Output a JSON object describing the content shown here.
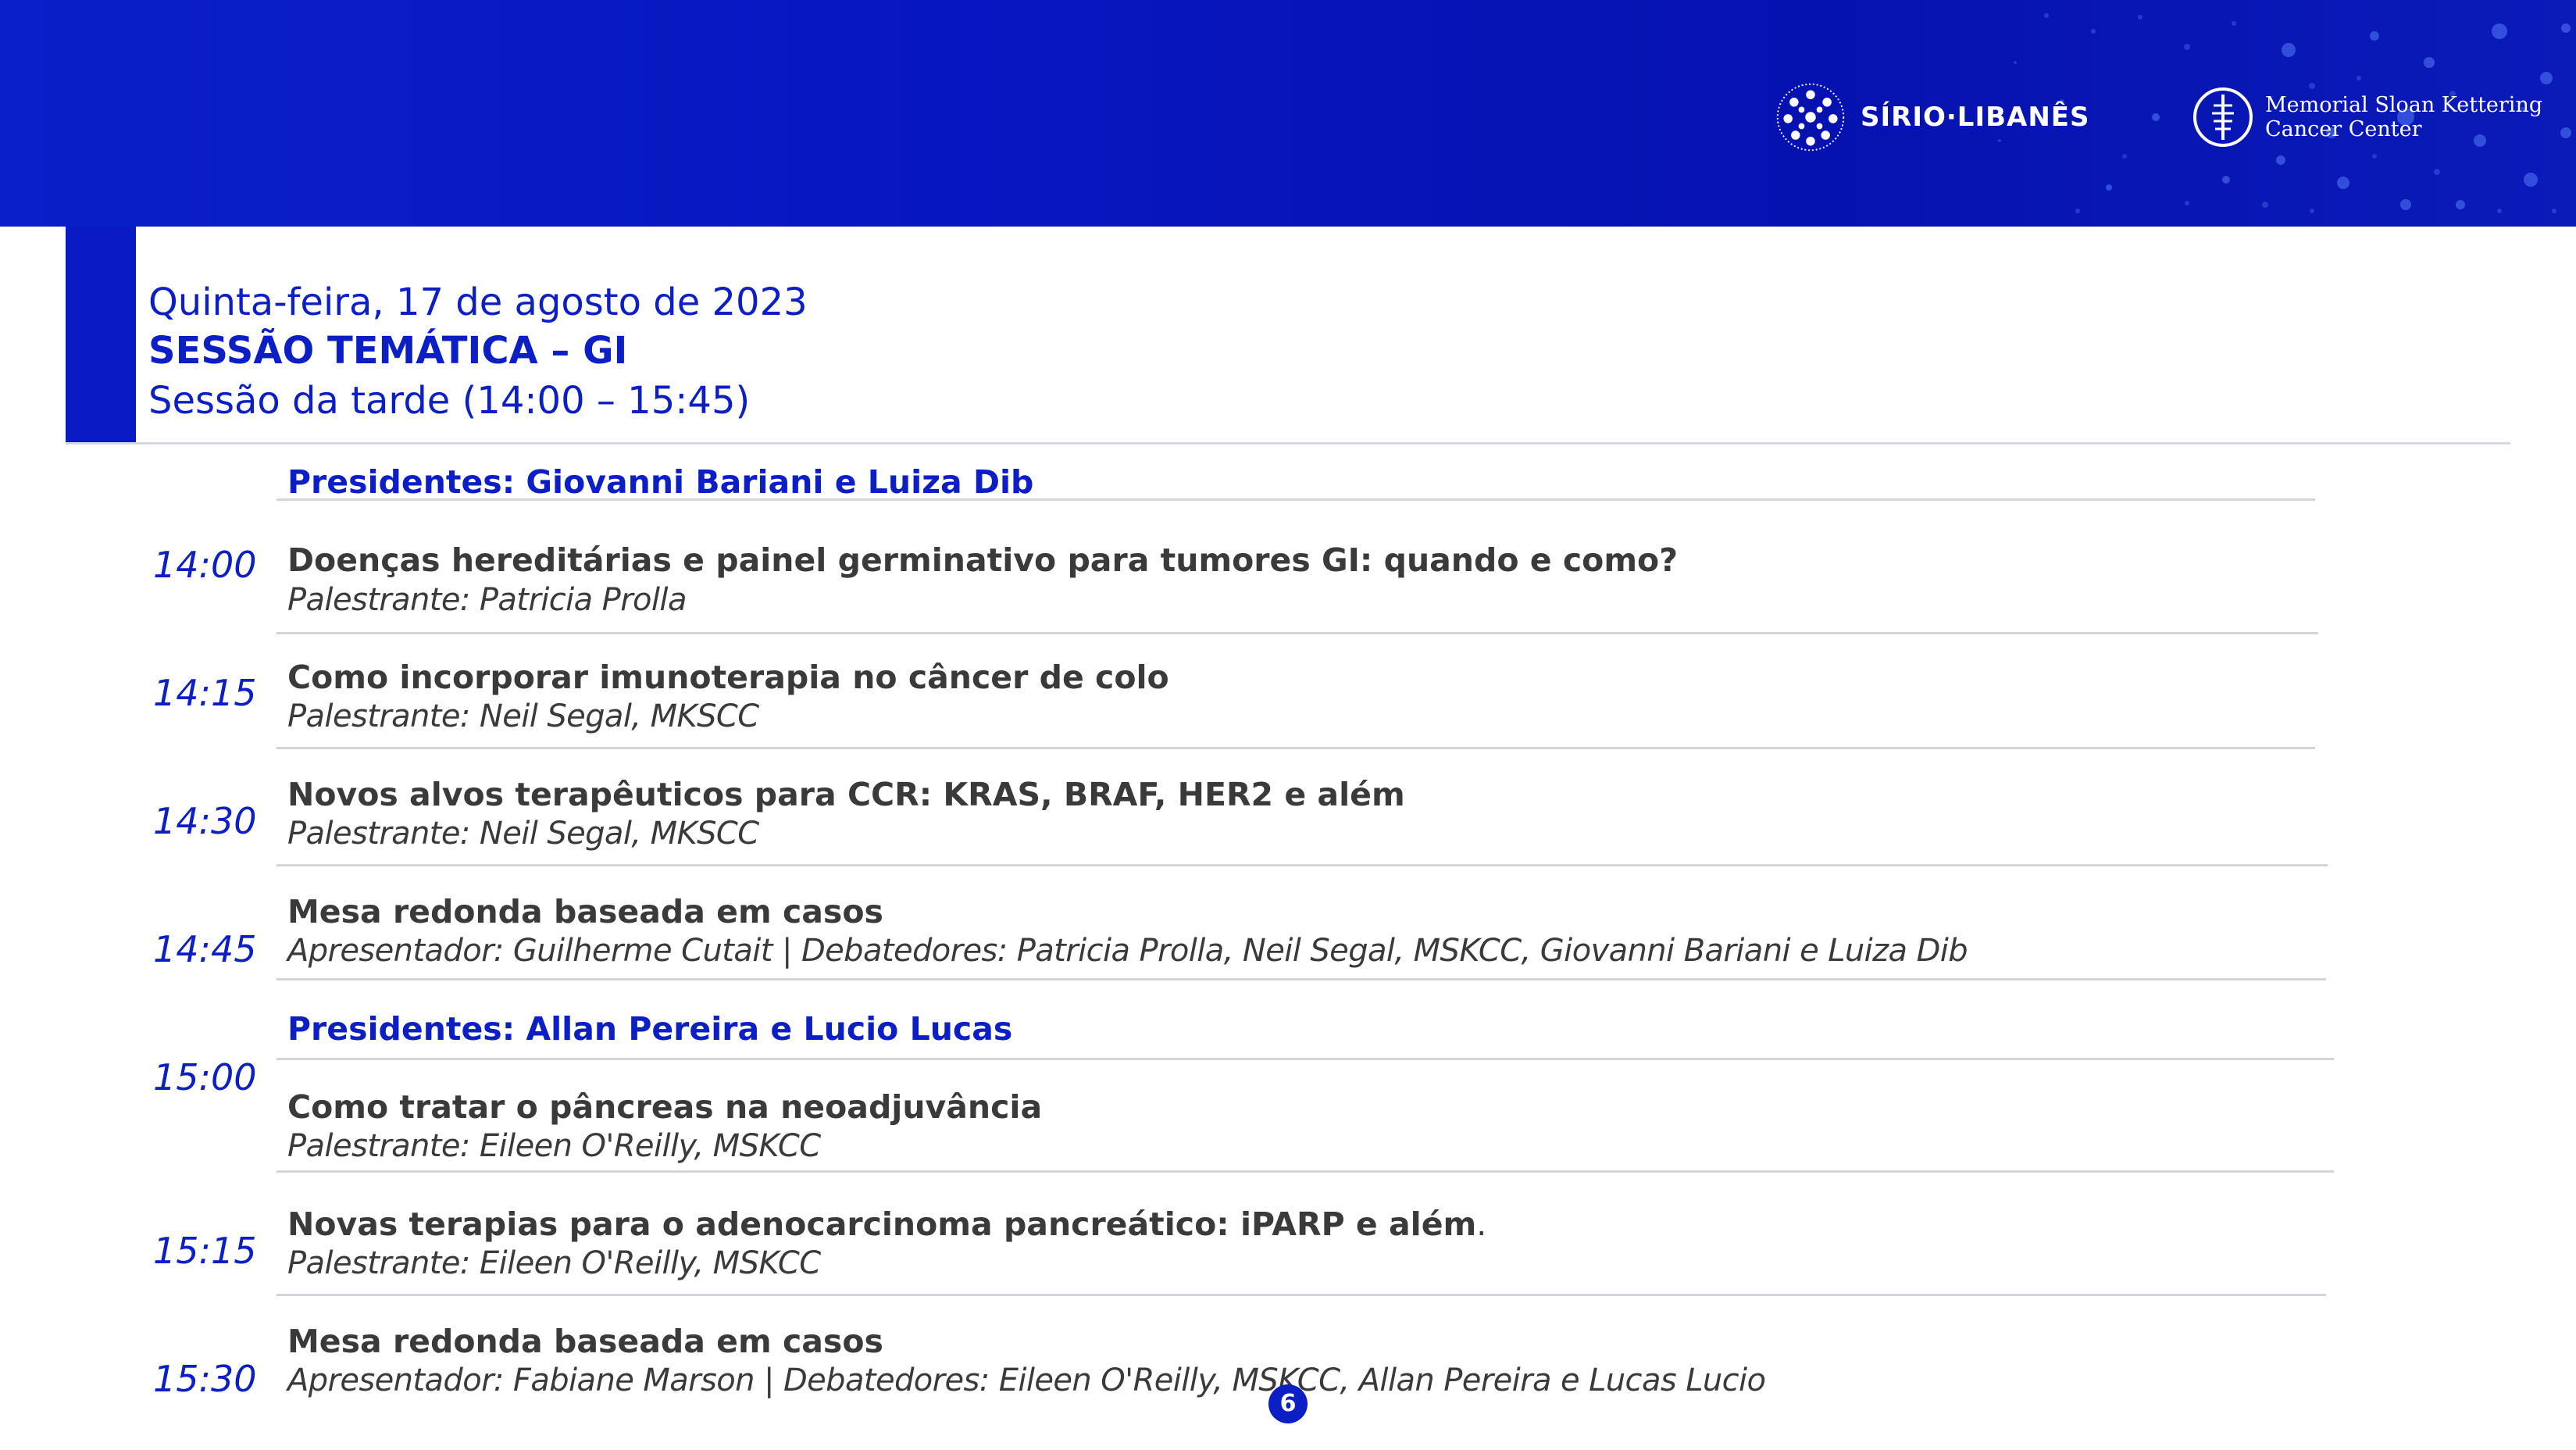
{
  "header": {
    "brand_sirio": "SÍRIO·LIBANÊS",
    "brand_msk_line1": "Memorial Sloan Kettering",
    "brand_msk_line2": "Cancer Center",
    "colors": {
      "brand_blue": "#0b1fc4",
      "text_dark": "#3a3a3a",
      "rule_gray": "#d4d4dc"
    }
  },
  "session": {
    "date": "Quinta-feira, 17 de agosto de 2023",
    "title": "SESSÃO TEMÁTICA – GI",
    "period": "Sessão da tarde (14:00 – 15:45)"
  },
  "blocks": [
    {
      "presidents": "Presidentes: Giovanni Bariani e Luiza Dib",
      "items": [
        {
          "time": "14:00",
          "title": "Doenças hereditárias e painel germinativo para tumores GI: quando e como?",
          "speaker": "Palestrante: Patricia Prolla"
        },
        {
          "time": "14:15",
          "title": "Como incorporar imunoterapia no câncer de colo",
          "speaker": "Palestrante: Neil Segal, MKSCC"
        },
        {
          "time": "14:30",
          "title": "Novos alvos terapêuticos para CCR: KRAS, BRAF, HER2 e além",
          "speaker": "Palestrante: Neil Segal, MKSCC"
        },
        {
          "time": "14:45",
          "title": "Mesa redonda baseada em casos",
          "speaker": "Apresentador: Guilherme Cutait | Debatedores: Patricia Prolla, Neil Segal, MSKCC, Giovanni Bariani e Luiza Dib"
        }
      ]
    },
    {
      "presidents": "Presidentes: Allan Pereira e Lucio Lucas",
      "items": [
        {
          "time": "15:00",
          "title": "Como tratar o pâncreas na neoadjuvância",
          "speaker": "Palestrante: Eileen O'Reilly, MSKCC"
        },
        {
          "time": "15:15",
          "title": "Novas terapias para o adenocarcinoma pancreático: iPARP e além",
          "title_suffix": ".",
          "speaker": "Palestrante: Eileen O'Reilly, MSKCC"
        },
        {
          "time": "15:30",
          "title": "Mesa redonda baseada em casos",
          "speaker": "Apresentador: Fabiane Marson | Debatedores: Eileen O'Reilly, MSKCC, Allan Pereira e Lucas Lucio"
        }
      ]
    }
  ],
  "page_number": "6"
}
